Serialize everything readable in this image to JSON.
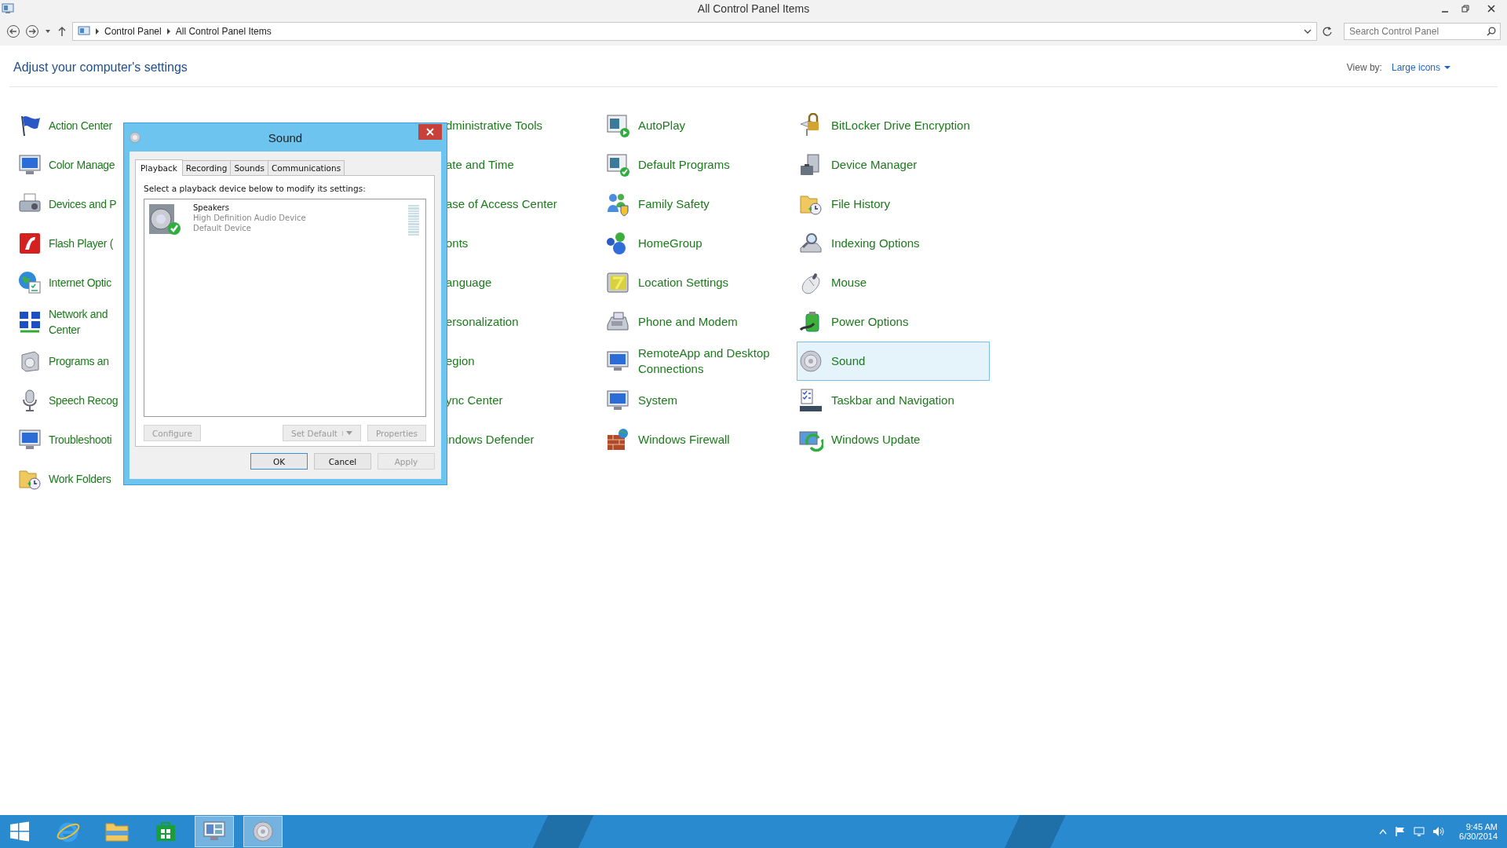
{
  "window": {
    "title": "All Control Panel Items"
  },
  "address_bar": {
    "breadcrumb": [
      "Control Panel",
      "All Control Panel Items"
    ]
  },
  "search": {
    "placeholder": "Search Control Panel"
  },
  "heading": "Adjust your computer's settings",
  "view_by": {
    "label": "View by:",
    "value": "Large icons"
  },
  "columns": [
    {
      "items": [
        {
          "label": "Action Center",
          "selected": false
        },
        {
          "label": "Color Manage",
          "selected": false
        },
        {
          "label": "Devices and P",
          "selected": false
        },
        {
          "label": "Flash Player (",
          "selected": false
        },
        {
          "label": "Internet Optic",
          "selected": false
        },
        {
          "label": "Network and Center",
          "selected": false
        },
        {
          "label": "Programs an",
          "selected": false
        },
        {
          "label": "Speech Recog",
          "selected": false
        },
        {
          "label": "Troubleshooti",
          "selected": false
        },
        {
          "label": "Work Folders",
          "selected": false
        }
      ]
    },
    {
      "items": [
        {
          "label": "dministrative Tools",
          "selected": false
        },
        {
          "label": "ate and Time",
          "selected": false
        },
        {
          "label": "ase of Access Center",
          "selected": false
        },
        {
          "label": "onts",
          "selected": false
        },
        {
          "label": "anguage",
          "selected": false
        },
        {
          "label": "ersonalization",
          "selected": false
        },
        {
          "label": "egion",
          "selected": false
        },
        {
          "label": "ync Center",
          "selected": false
        },
        {
          "label": "indows Defender",
          "selected": false
        }
      ]
    },
    {
      "items": [
        {
          "label": "AutoPlay",
          "selected": false
        },
        {
          "label": "Default Programs",
          "selected": false
        },
        {
          "label": "Family Safety",
          "selected": false
        },
        {
          "label": "HomeGroup",
          "selected": false
        },
        {
          "label": "Location Settings",
          "selected": false
        },
        {
          "label": "Phone and Modem",
          "selected": false
        },
        {
          "label": "RemoteApp and Desktop Connections",
          "selected": false
        },
        {
          "label": "System",
          "selected": false
        },
        {
          "label": "Windows Firewall",
          "selected": false
        }
      ]
    },
    {
      "items": [
        {
          "label": "BitLocker Drive Encryption",
          "selected": false
        },
        {
          "label": "Device Manager",
          "selected": false
        },
        {
          "label": "File History",
          "selected": false
        },
        {
          "label": "Indexing Options",
          "selected": false
        },
        {
          "label": "Mouse",
          "selected": false
        },
        {
          "label": "Power Options",
          "selected": false
        },
        {
          "label": "Sound",
          "selected": true
        },
        {
          "label": "Taskbar and Navigation",
          "selected": false
        },
        {
          "label": "Windows Update",
          "selected": false
        }
      ]
    }
  ],
  "dialog": {
    "title": "Sound",
    "tabs": [
      {
        "label": "Playback",
        "selected": true
      },
      {
        "label": "Recording",
        "selected": false
      },
      {
        "label": "Sounds",
        "selected": false
      },
      {
        "label": "Communications",
        "selected": false
      }
    ],
    "instruction": "Select a playback device below to modify its settings:",
    "devices": [
      {
        "name": "Speakers",
        "description": "High Definition Audio Device",
        "status": "Default Device",
        "level": 0
      }
    ],
    "device_buttons": [
      {
        "label": "Configure",
        "disabled": true
      },
      {
        "label": "Set Default",
        "disabled": true
      },
      {
        "label": "Properties",
        "disabled": true
      }
    ],
    "buttons": [
      {
        "label": "OK",
        "disabled": false,
        "default": true
      },
      {
        "label": "Cancel",
        "disabled": false,
        "default": false
      },
      {
        "label": "Apply",
        "disabled": true,
        "default": false
      }
    ]
  },
  "taskbar": {
    "apps": [
      {
        "active": false
      },
      {
        "active": false
      },
      {
        "active": false
      },
      {
        "active": false
      },
      {
        "active": true
      },
      {
        "active": true
      }
    ],
    "time": "9:45 AM",
    "date": "6/30/2014"
  }
}
